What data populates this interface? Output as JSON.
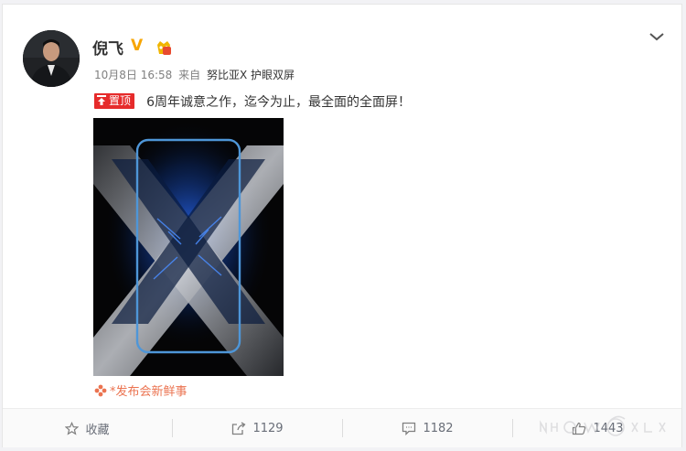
{
  "post": {
    "author": "倪飞",
    "verified_mark": "V",
    "timestamp": "10月8日 16:58",
    "via_prefix": "来自",
    "device": "努比亚X 护眼双屏",
    "pin_label": "置顶",
    "text": "6周年诚意之作，迄今为止，最全面的全面屏！",
    "topic_label": "*发布会新鲜事"
  },
  "actions": {
    "favorite_label": "收藏",
    "repost_count": "1129",
    "comment_count": "1182",
    "like_count": "1443"
  },
  "colors": {
    "verified": "#f7a500",
    "pin_badge": "#e62b2b",
    "topic": "#eb7350",
    "action_text": "#696e78"
  },
  "icons": {
    "menu": "chevron-down-icon",
    "favorite": "star-icon",
    "repost": "share-icon",
    "comment": "comment-icon",
    "like": "thumbs-up-icon"
  }
}
